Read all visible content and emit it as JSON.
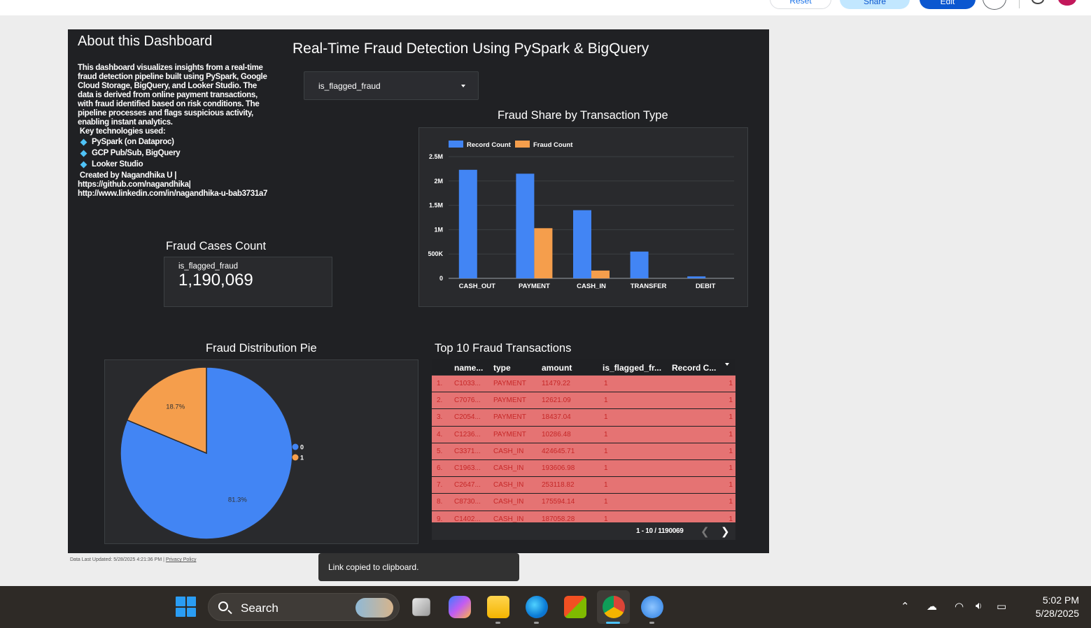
{
  "toolbar": {
    "reset_label": "Reset",
    "share_label": "Share",
    "edit_label": "Edit"
  },
  "about": {
    "title": "About this Dashboard",
    "description": "This dashboard visualizes insights from a real-time fraud detection pipeline built using PySpark, Google Cloud Storage, BigQuery, and Looker Studio. The data is derived from online payment transactions, with fraud identified based on risk conditions. The pipeline processes and flags suspicious activity, enabling instant analytics.",
    "tech_heading": " Key technologies used:",
    "technologies": [
      "PySpark (on Dataproc)",
      "GCP Pub/Sub, BigQuery",
      "Looker Studio"
    ],
    "credit_line1": " Created by Nagandhika U |",
    "credit_line2": "https://github.com/nagandhika|",
    "credit_line3": "http://www.linkedin.com/in/nagandhika-u-bab3731a7"
  },
  "main_title": "Real-Time Fraud Detection Using PySpark & BigQuery",
  "filter": {
    "label": "is_flagged_fraud"
  },
  "scorecard": {
    "title": "Fraud Cases Count",
    "metric_label": "is_flagged_fraud",
    "value": "1,190,069"
  },
  "bar_section": {
    "title": "Fraud Share by Transaction Type"
  },
  "pie_section": {
    "title": "Fraud Distribution Pie"
  },
  "table": {
    "title": "Top 10 Fraud Transactions",
    "columns": [
      "name...",
      "type",
      "amount",
      "is_flagged_fr...",
      "Record C..."
    ],
    "rows": [
      {
        "idx": "1.",
        "name": "C1033...",
        "type": "PAYMENT",
        "amount": "11479.22",
        "flag": "1",
        "count": "1"
      },
      {
        "idx": "2.",
        "name": "C7076...",
        "type": "PAYMENT",
        "amount": "12621.09",
        "flag": "1",
        "count": "1"
      },
      {
        "idx": "3.",
        "name": "C2054...",
        "type": "PAYMENT",
        "amount": "18437.04",
        "flag": "1",
        "count": "1"
      },
      {
        "idx": "4.",
        "name": "C1236...",
        "type": "PAYMENT",
        "amount": "10286.48",
        "flag": "1",
        "count": "1"
      },
      {
        "idx": "5.",
        "name": "C3371...",
        "type": "CASH_IN",
        "amount": "424645.71",
        "flag": "1",
        "count": "1"
      },
      {
        "idx": "6.",
        "name": "C1963...",
        "type": "CASH_IN",
        "amount": "193606.98",
        "flag": "1",
        "count": "1"
      },
      {
        "idx": "7.",
        "name": "C2647...",
        "type": "CASH_IN",
        "amount": "253118.82",
        "flag": "1",
        "count": "1"
      },
      {
        "idx": "8.",
        "name": "C8730...",
        "type": "CASH_IN",
        "amount": "175594.14",
        "flag": "1",
        "count": "1"
      },
      {
        "idx": "9.",
        "name": "C1402...",
        "type": "CASH_IN",
        "amount": "187058.28",
        "flag": "1",
        "count": "1"
      }
    ],
    "pagination": "1 - 10 / 1190069"
  },
  "footer": {
    "data_updated": "Data Last Updated: 5/28/2025 4:21:36 PM",
    "privacy": "Privacy Policy"
  },
  "toast": "Link copied to clipboard.",
  "taskbar": {
    "search_label": "Search",
    "time": "5:02 PM",
    "date": "5/28/2025",
    "apps": [
      "task-view-icon",
      "copilot-icon",
      "file-explorer-icon",
      "edge-icon",
      "store-icon",
      "chrome-icon",
      "paint-icon"
    ]
  },
  "colors": {
    "record_count": "#4285f4",
    "fraud_count": "#f59e4c",
    "table_row": "#e57373",
    "table_text": "#c62828",
    "canvas": "#202124",
    "panel": "#292a2d"
  },
  "chart_data": [
    {
      "type": "bar",
      "title": "Fraud Share by Transaction Type",
      "categories": [
        "CASH_OUT",
        "PAYMENT",
        "CASH_IN",
        "TRANSFER",
        "DEBIT"
      ],
      "series": [
        {
          "name": "Record Count",
          "values": [
            2230000,
            2150000,
            1400000,
            550000,
            40000
          ]
        },
        {
          "name": "Fraud Count",
          "values": [
            0,
            1030000,
            160000,
            0,
            0
          ]
        }
      ],
      "ylim": [
        0,
        2500000
      ],
      "yticks": [
        0,
        500000,
        1000000,
        1500000,
        2000000,
        2500000
      ],
      "ytick_labels": [
        "0",
        "500K",
        "1M",
        "1.5M",
        "2M",
        "2.5M"
      ],
      "legend": "top-left",
      "grid": true
    },
    {
      "type": "pie",
      "title": "Fraud Distribution Pie",
      "labels": [
        "0",
        "1"
      ],
      "values": [
        81.3,
        18.7
      ],
      "value_labels": [
        "81.3%",
        "18.7%"
      ],
      "legend": "right"
    }
  ]
}
